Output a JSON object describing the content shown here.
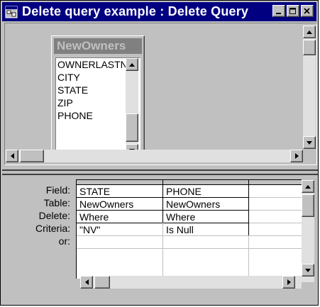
{
  "window": {
    "title": "Delete query example : Delete Query",
    "buttons": {
      "minimize": "minimize",
      "maximize": "maximize",
      "close": "close"
    }
  },
  "field_list": {
    "table_name": "NewOwners",
    "items": [
      "OWNERLASTNAME",
      "CITY",
      "STATE",
      "ZIP",
      "PHONE"
    ]
  },
  "grid": {
    "row_labels": [
      "Field:",
      "Table:",
      "Delete:",
      "Criteria:",
      "or:"
    ],
    "columns": [
      {
        "field": "STATE",
        "table": "NewOwners",
        "delete": "Where",
        "criteria": "\"NV\"",
        "or": ""
      },
      {
        "field": "PHONE",
        "table": "NewOwners",
        "delete": "Where",
        "criteria": "Is Null",
        "or": ""
      },
      {
        "field": "",
        "table": "",
        "delete": "",
        "criteria": "",
        "or": ""
      }
    ]
  },
  "colors": {
    "title_bar": "#000080",
    "face": "#c0c0c0",
    "field_list_header": "#808080"
  }
}
